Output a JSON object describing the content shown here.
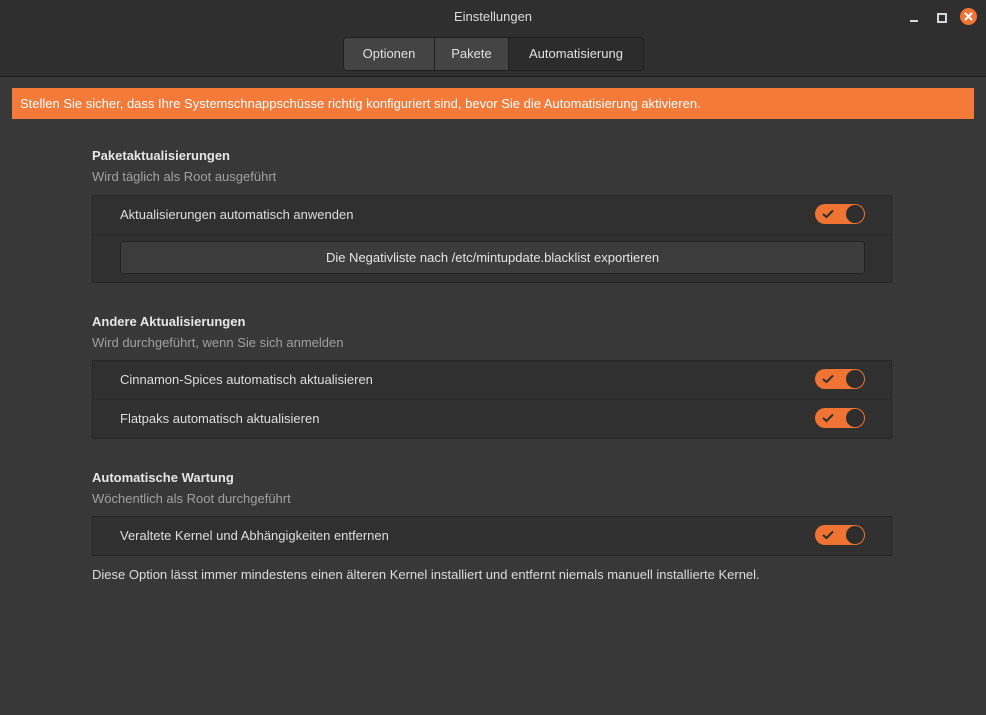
{
  "window": {
    "title": "Einstellungen"
  },
  "tabs": [
    {
      "label": "Optionen"
    },
    {
      "label": "Pakete"
    },
    {
      "label": "Automatisierung"
    }
  ],
  "active_tab": "Automatisierung",
  "banner": {
    "text": "Stellen Sie sicher, dass Ihre Systemschnappschüsse richtig konfiguriert sind, bevor Sie die Automatisierung aktivieren.",
    "color": "#f47a3a"
  },
  "sections": {
    "package": {
      "title": "Paketaktualisierungen",
      "subtitle": "Wird täglich als Root ausgeführt",
      "toggle_label": "Aktualisierungen automatisch anwenden",
      "toggle_on": true,
      "export_button": "Die Negativliste nach /etc/mintupdate.blacklist exportieren"
    },
    "other": {
      "title": "Andere Aktualisierungen",
      "subtitle": "Wird durchgeführt, wenn Sie sich anmelden",
      "items": [
        {
          "label": "Cinnamon-Spices automatisch aktualisieren",
          "on": true
        },
        {
          "label": "Flatpaks automatisch aktualisieren",
          "on": true
        }
      ]
    },
    "maintenance": {
      "title": "Automatische Wartung",
      "subtitle": "Wöchentlich als Root durchgeführt",
      "toggle_label": "Veraltete Kernel und Abhängigkeiten entfernen",
      "toggle_on": true,
      "note": "Diese Option lässt immer mindestens einen älteren Kernel installiert und entfernt niemals manuell installierte Kernel."
    }
  },
  "colors": {
    "accent": "#ef7332",
    "background": "#383838"
  }
}
